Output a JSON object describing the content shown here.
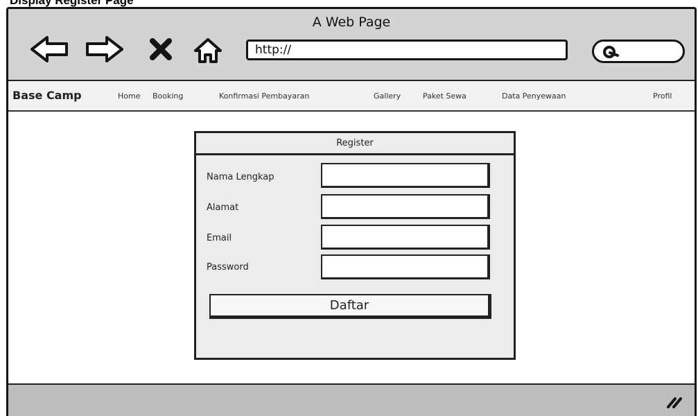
{
  "caption": "Display Register Page",
  "window": {
    "title": "A Web Page",
    "url": "http://"
  },
  "nav_icons": {
    "back": "back-arrow-icon",
    "forward": "forward-arrow-icon",
    "stop": "close-icon",
    "home": "home-icon",
    "search": "search-icon",
    "resize": "resize-grip-icon"
  },
  "navbar": {
    "brand": "Base Camp",
    "links": [
      "Home",
      "Booking",
      "Konfirmasi Pembayaran",
      "Gallery",
      "Paket Sewa",
      "Data Penyewaan"
    ],
    "profile": "Profil"
  },
  "form": {
    "title": "Register",
    "fields": [
      {
        "label": "Nama Lengkap",
        "value": ""
      },
      {
        "label": "Alamat",
        "value": ""
      },
      {
        "label": "Email",
        "value": ""
      },
      {
        "label": "Password",
        "value": ""
      }
    ],
    "submit_label": "Daftar"
  },
  "colors": {
    "titlebar_bg": "#d3d3d3",
    "navbar_bg": "#f1f1f1",
    "panel_bg": "#ececec",
    "statusbar_bg": "#bdbdbd",
    "stroke": "#141414"
  }
}
